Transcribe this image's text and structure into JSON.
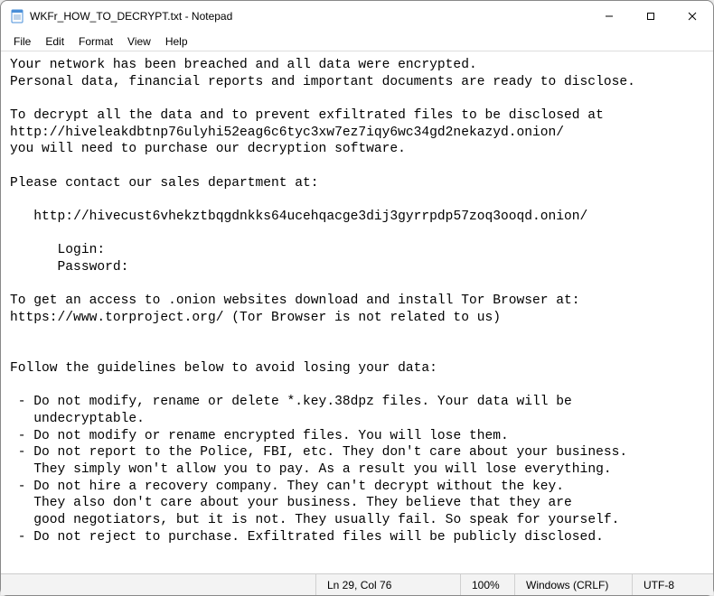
{
  "window": {
    "title": "WKFr_HOW_TO_DECRYPT.txt - Notepad"
  },
  "menu": {
    "file": "File",
    "edit": "Edit",
    "format": "Format",
    "view": "View",
    "help": "Help"
  },
  "body": {
    "text": "Your network has been breached and all data were encrypted.\nPersonal data, financial reports and important documents are ready to disclose.\n\nTo decrypt all the data and to prevent exfiltrated files to be disclosed at\nhttp://hiveleakdbtnp76ulyhi52eag6c6tyc3xw7ez7iqy6wc34gd2nekazyd.onion/\nyou will need to purchase our decryption software.\n\nPlease contact our sales department at:\n\n   http://hivecust6vhekztbqgdnkks64ucehqacge3dij3gyrrpdp57zoq3ooqd.onion/\n\n      Login:\n      Password:\n\nTo get an access to .onion websites download and install Tor Browser at:\nhttps://www.torproject.org/ (Tor Browser is not related to us)\n\n\nFollow the guidelines below to avoid losing your data:\n\n - Do not modify, rename or delete *.key.38dpz files. Your data will be \n   undecryptable.\n - Do not modify or rename encrypted files. You will lose them.\n - Do not report to the Police, FBI, etc. They don't care about your business.\n   They simply won't allow you to pay. As a result you will lose everything.\n - Do not hire a recovery company. They can't decrypt without the key.\n   They also don't care about your business. They believe that they are\n   good negotiators, but it is not. They usually fail. So speak for yourself.\n - Do not reject to purchase. Exfiltrated files will be publicly disclosed."
  },
  "status": {
    "position": "Ln 29, Col 76",
    "zoom": "100%",
    "lineending": "Windows (CRLF)",
    "encoding": "UTF-8"
  }
}
